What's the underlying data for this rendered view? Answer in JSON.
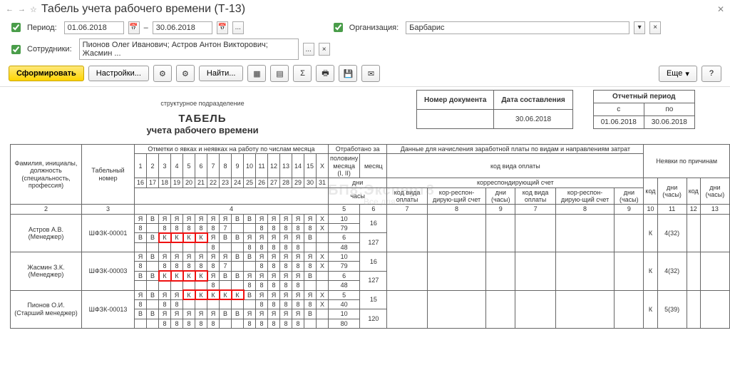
{
  "title": "Табель учета рабочего времени (Т-13)",
  "filters": {
    "period_label": "Период:",
    "date_from": "01.06.2018",
    "date_to": "30.06.2018",
    "separator": "–",
    "org_label": "Организация:",
    "org_value": "Барбарис",
    "emp_label": "Сотрудники:",
    "emp_value": "Пионов Олег Иванович; Астров Антон Викторович; Жасмин ..."
  },
  "toolbar": {
    "generate": "Сформировать",
    "settings": "Настройки...",
    "find": "Найти...",
    "more": "Еще",
    "help": "?"
  },
  "doc": {
    "struct_label": "структурное подразделение",
    "title1": "ТАБЕЛЬ",
    "title2": "учета  рабочего времени",
    "meta": {
      "doc_no_h": "Номер документа",
      "doc_date_h": "Дата составления",
      "doc_date_v": "30.06.2018",
      "period_h": "Отчетный период",
      "from_h": "с",
      "to_h": "по",
      "from_v": "01.06.2018",
      "to_v": "30.06.2018"
    },
    "headers": {
      "fio": "Фамилия, инициалы, должность (специальность, профессия)",
      "tab_no": "Табельный номер",
      "marks": "Отметки о явках и неявках на работу по числам месяца",
      "worked": "Отработано за",
      "half": "половину месяца (I, II)",
      "month": "месяц",
      "days": "дни",
      "hours": "часы",
      "pay": "Данные для начисления заработной платы по видам и направлениям затрат",
      "pay_code": "код вида оплаты",
      "corr": "корреспондирующий счет",
      "code_col": "код вида оплаты",
      "corr_col": "кор-респон-дирую-щий счет",
      "days_h": "дни (часы)",
      "abs": "Неявки по причинам",
      "code": "код",
      "dh": "дни (часы)"
    },
    "col_nums": {
      "c2": "2",
      "c3": "3",
      "c4": "4",
      "c5": "5",
      "c6": "6",
      "c7": "7",
      "c8": "8",
      "c9": "9",
      "c7a": "7",
      "c8a": "8",
      "c9a": "9",
      "c10": "10",
      "c11": "11",
      "c12": "12",
      "c13": "13"
    },
    "days_top": [
      "1",
      "2",
      "3",
      "4",
      "5",
      "6",
      "7",
      "8",
      "9",
      "10",
      "11",
      "12",
      "13",
      "14",
      "15",
      "X"
    ],
    "days_bot": [
      "16",
      "17",
      "18",
      "19",
      "20",
      "21",
      "22",
      "23",
      "24",
      "25",
      "26",
      "27",
      "28",
      "29",
      "30",
      "31"
    ],
    "rows": [
      {
        "name": "Астров А.В. (Менеджер)",
        "tab": "ШФЗК-00001",
        "r1": [
          "Я",
          "В",
          "Я",
          "Я",
          "Я",
          "Я",
          "Я",
          "Я",
          "В",
          "В",
          "Я",
          "Я",
          "Я",
          "Я",
          "Я",
          "X"
        ],
        "r2": [
          "8",
          "",
          "8",
          "8",
          "8",
          "8",
          "8",
          "7",
          "",
          "",
          "8",
          "8",
          "8",
          "8",
          "8",
          "X"
        ],
        "r3": [
          "В",
          "В",
          "К",
          "К",
          "К",
          "К",
          "Я",
          "В",
          "В",
          "Я",
          "Я",
          "Я",
          "Я",
          "Я",
          "В",
          ""
        ],
        "r4": [
          "",
          "",
          "",
          "",
          "",
          "",
          "8",
          "",
          "",
          "8",
          "8",
          "8",
          "8",
          "8",
          "",
          ""
        ],
        "red_row": 2,
        "red_from": 2,
        "red_to": 5,
        "half": [
          "10",
          "79",
          "6",
          "48"
        ],
        "month": [
          "16",
          "127"
        ],
        "abs_code": "К",
        "abs_val": "4(32)"
      },
      {
        "name": "Жасмин З.К. (Менеджер)",
        "tab": "ШФЗК-00003",
        "r1": [
          "Я",
          "В",
          "Я",
          "Я",
          "Я",
          "Я",
          "Я",
          "Я",
          "В",
          "В",
          "Я",
          "Я",
          "Я",
          "Я",
          "Я",
          "X"
        ],
        "r2": [
          "8",
          "",
          "8",
          "8",
          "8",
          "8",
          "8",
          "7",
          "",
          "",
          "8",
          "8",
          "8",
          "8",
          "8",
          "X"
        ],
        "r3": [
          "В",
          "В",
          "К",
          "К",
          "К",
          "К",
          "Я",
          "В",
          "В",
          "Я",
          "Я",
          "Я",
          "Я",
          "Я",
          "В",
          ""
        ],
        "r4": [
          "",
          "",
          "",
          "",
          "",
          "",
          "8",
          "",
          "",
          "8",
          "8",
          "8",
          "8",
          "8",
          "",
          ""
        ],
        "red_row": 2,
        "red_from": 2,
        "red_to": 5,
        "half": [
          "10",
          "79",
          "6",
          "48"
        ],
        "month": [
          "16",
          "127"
        ],
        "abs_code": "К",
        "abs_val": "4(32)"
      },
      {
        "name": "Пионов О.И. (Старший менеджер)",
        "tab": "ШФЗК-00013",
        "r1": [
          "Я",
          "В",
          "Я",
          "Я",
          "К",
          "К",
          "К",
          "К",
          "К",
          "В",
          "Я",
          "Я",
          "Я",
          "Я",
          "Я",
          "X"
        ],
        "r2": [
          "8",
          "",
          "8",
          "8",
          "",
          "",
          "",
          "",
          "",
          "",
          "8",
          "8",
          "8",
          "8",
          "8",
          "X"
        ],
        "r3": [
          "В",
          "В",
          "Я",
          "Я",
          "Я",
          "Я",
          "Я",
          "В",
          "В",
          "Я",
          "Я",
          "Я",
          "Я",
          "Я",
          "В",
          ""
        ],
        "r4": [
          "",
          "",
          "8",
          "8",
          "8",
          "8",
          "8",
          "",
          "",
          "8",
          "8",
          "8",
          "8",
          "8",
          "",
          ""
        ],
        "red_row": 0,
        "red_from": 4,
        "red_to": 8,
        "half": [
          "5",
          "40",
          "10",
          "80"
        ],
        "month": [
          "15",
          "120"
        ],
        "abs_code": "К",
        "abs_val": "5(39)"
      }
    ]
  }
}
